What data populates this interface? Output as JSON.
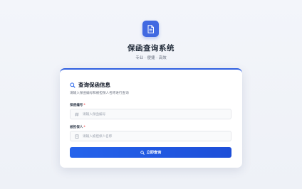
{
  "header": {
    "logo_icon": "document-icon",
    "title": "保函查询系统",
    "subtitle": "专业 · 便捷 · 高效"
  },
  "card": {
    "title_icon": "search-icon",
    "title": "查询保函信息",
    "description": "请输入保函编号和被担保人名称进行查询",
    "fields": {
      "number": {
        "label": "保函编号",
        "required_mark": "*",
        "icon": "hash-icon",
        "placeholder": "请输入保函编号",
        "value": ""
      },
      "guarantee": {
        "label": "被担保人",
        "required_mark": "*",
        "icon": "building-icon",
        "placeholder": "请输入被担保人名称",
        "value": ""
      }
    },
    "submit_label": "立即查询",
    "submit_icon": "search-icon"
  },
  "colors": {
    "accent": "#2f5fe0",
    "button": "#2563eb",
    "required": "#ef4444"
  }
}
